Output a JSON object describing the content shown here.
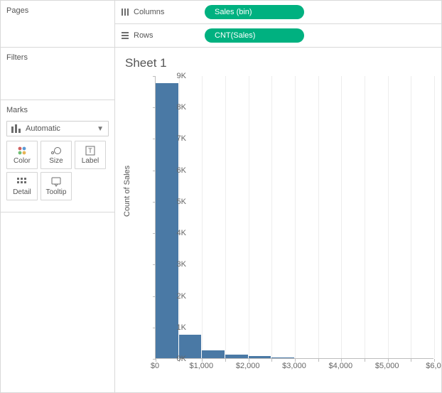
{
  "sidebar": {
    "pages_title": "Pages",
    "filters_title": "Filters",
    "marks_title": "Marks",
    "marks_select_label": "Automatic",
    "buttons": {
      "color": "Color",
      "size": "Size",
      "label": "Label",
      "detail": "Detail",
      "tooltip": "Tooltip"
    }
  },
  "shelves": {
    "columns_label": "Columns",
    "rows_label": "Rows",
    "columns_pill": "Sales (bin)",
    "rows_pill": "CNT(Sales)"
  },
  "viz": {
    "title": "Sheet 1",
    "y_axis_title": "Count of Sales",
    "y_ticks": [
      "0K",
      "1K",
      "2K",
      "3K",
      "4K",
      "5K",
      "6K",
      "7K",
      "8K",
      "9K"
    ],
    "x_ticks": [
      "$0",
      "$1,000",
      "$2,000",
      "$3,000",
      "$4,000",
      "$5,000",
      "$6,0"
    ]
  },
  "chart_data": {
    "type": "bar",
    "title": "Sheet 1",
    "xlabel": "Sales (bin)",
    "ylabel": "Count of Sales",
    "ylim": [
      0,
      9000
    ],
    "xlim": [
      0,
      6000
    ],
    "bin_width": 500,
    "bins_start": [
      0,
      500,
      1000,
      1500,
      2000,
      2500
    ],
    "values": [
      8750,
      750,
      250,
      120,
      60,
      30
    ]
  }
}
